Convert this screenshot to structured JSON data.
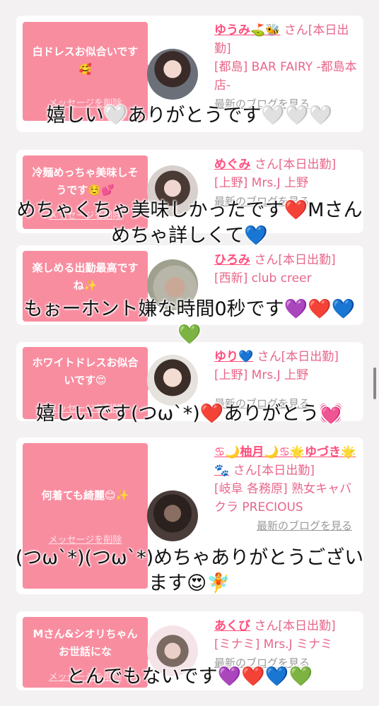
{
  "cards": [
    {
      "message": "白ドレスお似合いです🥰",
      "delete": "メッセージを削除",
      "name": "ゆうみ⛳️🐝",
      "san": " さん[本日出勤]",
      "shop": "[都島] BAR FAIRY -都島本店-",
      "blog": "最新のブログを見る"
    },
    {
      "message": "冷麺めっちゃ美味しそうです☺️💕",
      "delete": "メッセージを削除",
      "name": "めぐみ",
      "san": " さん[本日出勤]",
      "shop": "[上野] Mrs.J 上野",
      "blog": "最新のブログを見る"
    },
    {
      "message": "楽しめる出勤最高ですね✨",
      "delete": "メッセージを削除",
      "name": "ひろみ",
      "san": " さん[本日出勤]",
      "shop": "[西新] club creer",
      "blog": "最新のブログを見る"
    },
    {
      "message": "ホワイトドレスお似合いです😍",
      "delete": "メッセージを削除",
      "name": "ゆり💙",
      "san": " さん[本日出勤]",
      "shop": "[上野] Mrs.J 上野",
      "blog": "最新のブログを見る"
    },
    {
      "message": "何着ても綺麗😊✨",
      "delete": "メッセージを削除",
      "name": "♋︎🌙柚月🌙♋︎🌟ゆづき🌟🐾",
      "san": " さん[本日出勤]",
      "shop": "[岐阜 各務原] 熟女キャバクラ PRECIOUS",
      "blog": "最新のブログを見る"
    },
    {
      "message": "Mさん&シオリちゃんお世話にな",
      "delete": "メッセージを削除",
      "name": "あくび",
      "san": " さん[本日出勤]",
      "shop": "[ミナミ] Mrs.J ミナミ",
      "blog": "最新のブログを見る"
    }
  ],
  "captions": [
    "嬉しい🤍ありがとうです🤍🤍🤍",
    "めちゃくちゃ美味しかったです❤️Mさんめちゃ詳しくて💙",
    "もぉーホント嫌な時間0秒です💜❤️💙💚",
    "嬉しいです(つω`*)❤️ありがとう💓",
    "(つω`*)(つω`*)めちゃありがとうございます😍🧚",
    "とんでもないです💜❤️💙💚"
  ],
  "colors": {
    "accent": "#f98da0",
    "name": "#ff4d7d",
    "background": "#f3f1f2"
  }
}
